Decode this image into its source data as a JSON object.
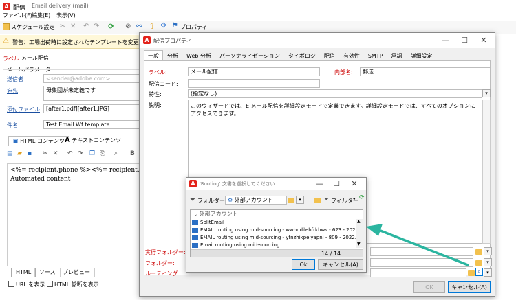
{
  "main_window": {
    "title": "配信",
    "title_sub": "Email delivery (mail)",
    "menu": [
      "ファイル(F)",
      "編集(E)",
      "表示(V)"
    ],
    "toolbar": {
      "schedule": "スケジュール設定",
      "properties": "プロパティ"
    },
    "warning": "警告：工場出荷時に設定されたテンプレートを変更し",
    "label_caption": "ラベル:",
    "label_value": "メール配信",
    "mail_params": "メールパラメーター",
    "sender_caption": "送信者",
    "sender_value": "<sender@adobe.com>",
    "to_caption": "宛先",
    "to_value": "母集団が未定義です",
    "attach_caption": "添付ファイル",
    "attach_value": "[after1.pdf][after1.JPG]",
    "subject_caption": "件名",
    "subject_value": "Test Email Wf template",
    "content_tabs": [
      "HTML コンテンツ",
      "テキストコンテンツ"
    ],
    "content_lines": [
      "<%= recipient.phone %><%= recipient.mobi",
      "Automated content"
    ],
    "bottom_tabs": [
      "HTML",
      "ソース",
      "プレビュー"
    ],
    "show_url": "URL を表示",
    "html_analysis": "HTML 診断を表示"
  },
  "props_dialog": {
    "title": "配信プロパティ",
    "tabs": [
      "一般",
      "分析",
      "Web 分析",
      "パーソナライゼーション",
      "タイポロジ",
      "配信",
      "有効性",
      "SMTP",
      "承認",
      "詳細設定"
    ],
    "label_caption": "ラベル:",
    "label_value": "メール配信",
    "internal_caption": "内部名:",
    "internal_value": "郵送",
    "code_caption": "配信コード:",
    "nature_caption": "特性:",
    "nature_value": "(指定なし)",
    "desc_caption": "説明:",
    "desc_value": "このウィザードでは、E メール配信を詳細設定モードで定義できます。詳細設定モードでは、すべてのオプションにアクセスできます。",
    "exec_folder": "実行フォルダー:",
    "folder": "フォルダー:",
    "routing": "ルーティング:",
    "ok": "OK",
    "cancel": "キャンセル(A)"
  },
  "select_dialog": {
    "title": "'Routing' 文書を選択してください",
    "folder_caption": "フォルダー:",
    "folder_value": "外部アカウント",
    "filter": "フィルター",
    "list_header": "外部アカウント",
    "items": [
      "SplitEmail",
      "EMAIL routing using mid-sourcing - wwhndilehfrkhws - 623 - 2022...",
      "EMAIL routing using mid-sourcing - ytnzhikpeiyapnj - 809 - 2022...",
      "Email routing using mid-sourcing"
    ],
    "count": "14 / 14",
    "ok": "Ok",
    "cancel": "キャンセル(A)"
  },
  "colors": {
    "accent": "#0078d7",
    "arrow": "#2bb5a0",
    "adobe": "#e3231b",
    "label_red": "#c00000"
  }
}
